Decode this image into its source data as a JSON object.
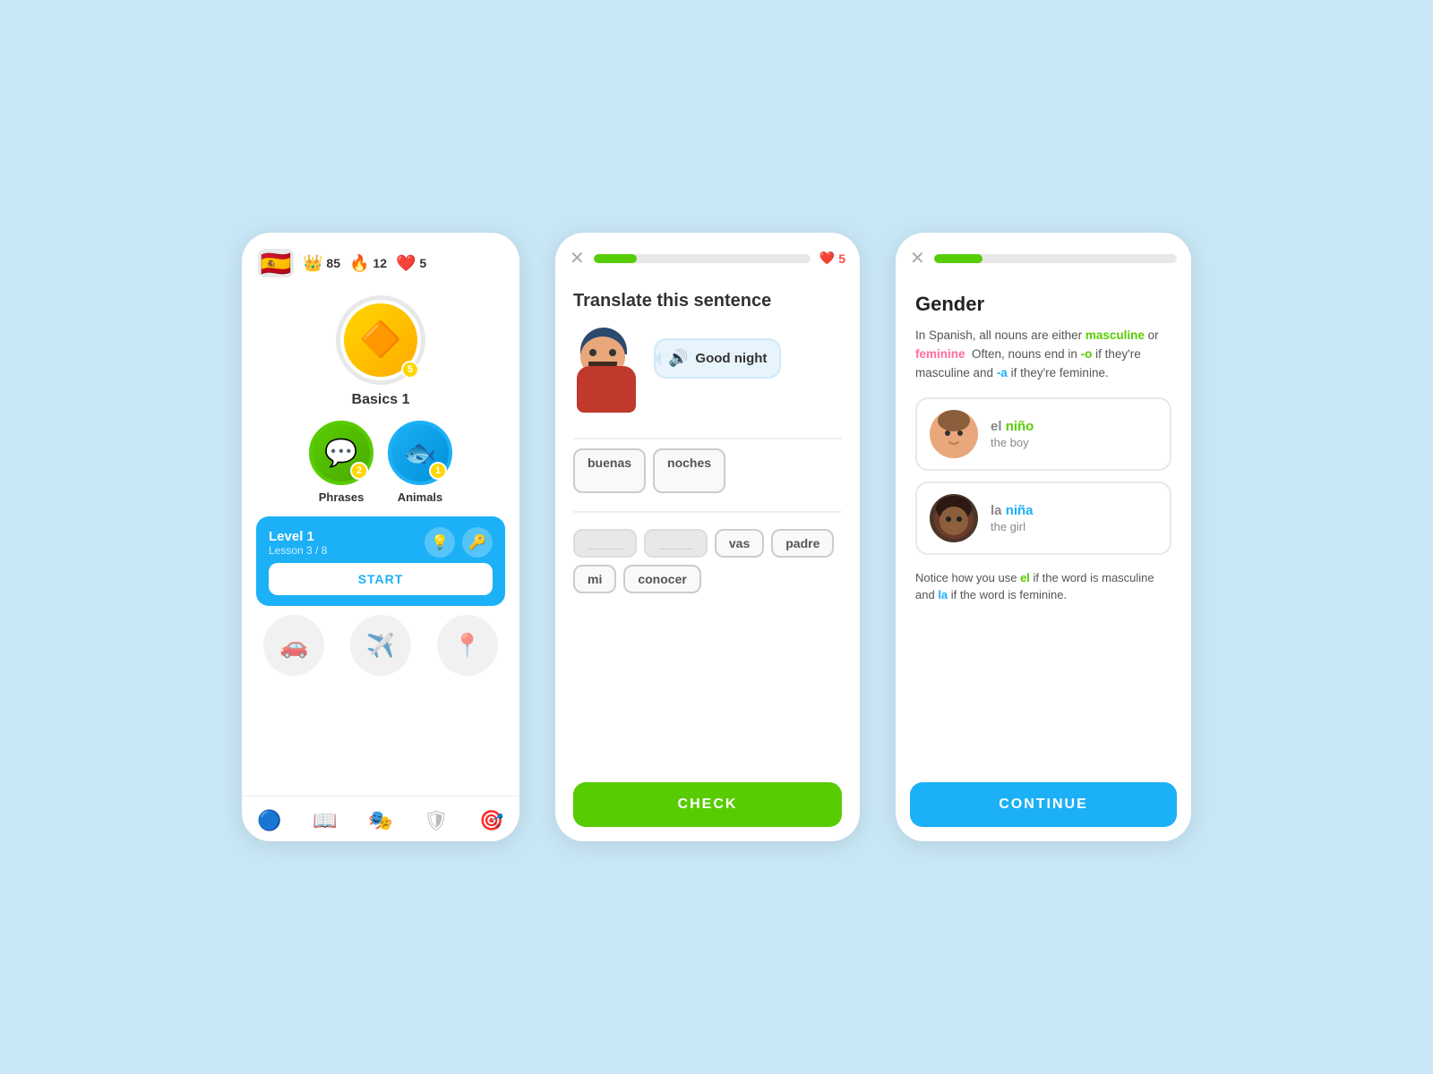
{
  "bg_color": "#c8e6f5",
  "screen1": {
    "flag": "🇪🇸",
    "stats": {
      "crown_icon": "👑",
      "crown_count": "85",
      "fire_icon": "🔥",
      "fire_count": "12",
      "heart_icon": "❤️",
      "heart_count": "5"
    },
    "basics": {
      "label": "Basics 1",
      "badge": "5",
      "emoji": "🔶"
    },
    "lessons": [
      {
        "label": "Phrases",
        "emoji": "💬",
        "badge": "2",
        "color": "green"
      },
      {
        "label": "Animals",
        "emoji": "🐟",
        "badge": "1",
        "color": "blue"
      }
    ],
    "level": {
      "title": "Level 1",
      "subtitle": "Lesson 3 / 8",
      "start_label": "START"
    },
    "locked": [
      "🚗",
      "✈️",
      "📍"
    ],
    "footer_icons": [
      "🔵",
      "📖",
      "🎭",
      "🛡",
      "🎯"
    ]
  },
  "screen2": {
    "close_label": "✕",
    "progress": 20,
    "heart_count": "5",
    "title": "Translate this sentence",
    "speech_text": "Good night",
    "divider": true,
    "placed_words": [
      "buenas",
      "noches"
    ],
    "word_bank": [
      "vas",
      "padre",
      "mi",
      "conocer"
    ],
    "check_label": "CHECK"
  },
  "screen3": {
    "close_label": "✕",
    "progress": 20,
    "title": "Gender",
    "description_parts": [
      "In Spanish, all nouns are either ",
      "masculine",
      " or ",
      "feminine",
      "  Often, nouns end in ",
      "-o",
      " if they're masculine and ",
      "-a",
      " if they're feminine."
    ],
    "examples": [
      {
        "word_prefix": "el ",
        "word_main": "niño",
        "translation": "the boy",
        "avatar_type": "boy"
      },
      {
        "word_prefix": "la ",
        "word_main": "niña",
        "translation": "the girl",
        "avatar_type": "girl"
      }
    ],
    "note_parts": [
      "Notice how you use ",
      "el",
      " if the word is masculine and ",
      "la",
      " if the word is feminine."
    ],
    "continue_label": "CONTINUE"
  }
}
